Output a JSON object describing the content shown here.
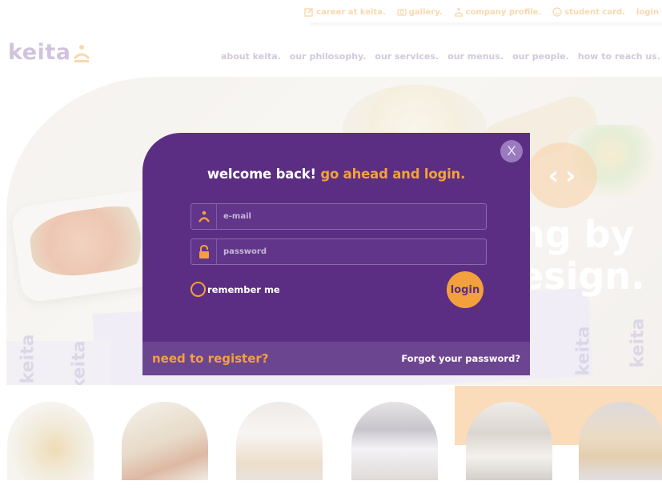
{
  "topbar": {
    "links": [
      {
        "label": "career at keita.",
        "icon": "edit-icon"
      },
      {
        "label": "gallery.",
        "icon": "camera-icon"
      },
      {
        "label": "company profile.",
        "icon": "keita-person-icon"
      },
      {
        "label": "student card.",
        "icon": "smile-icon"
      },
      {
        "label": "login",
        "icon": ""
      }
    ]
  },
  "brand": {
    "logo_text": "keita"
  },
  "nav": {
    "items": [
      "about keita.",
      "our philosophy.",
      "our services.",
      "our menus.",
      "our people.",
      "how to reach us."
    ]
  },
  "hero": {
    "slogan_line1": "ng by",
    "slogan_line2": "esign.",
    "slider_prev": "‹",
    "slider_next": "›",
    "watermark": "keita"
  },
  "modal": {
    "close_label": "X",
    "heading_white": "welcome back!",
    "heading_orange": "go ahead and login.",
    "email_placeholder": "e-mail",
    "password_placeholder": "password",
    "remember_label": "remember me",
    "login_button": "login",
    "register_label": "need to register?",
    "forgot_label": "Forgot your password?"
  },
  "colors": {
    "modal_purple": "#5c2e83",
    "accent_orange": "#f3a13c",
    "footer_purple": "#6c4591"
  }
}
